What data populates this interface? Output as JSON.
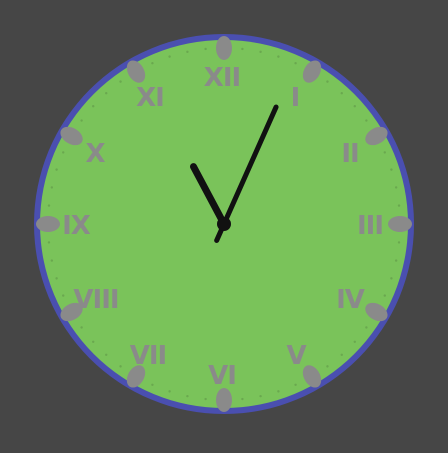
{
  "clock": {
    "numerals": [
      "XII",
      "I",
      "II",
      "III",
      "IV",
      "V",
      "VI",
      "VII",
      "VIII",
      "IX",
      "X",
      "XI"
    ],
    "time": {
      "hours": 11,
      "minutes": 4
    },
    "colors": {
      "background": "#464646",
      "face": "#7ac35a",
      "rim": "#4a4fb0",
      "numerals": "#8a8a8a",
      "markers": "#8a8a8a",
      "minute_ticks": "#6aa84f",
      "hands": "#111111"
    }
  }
}
